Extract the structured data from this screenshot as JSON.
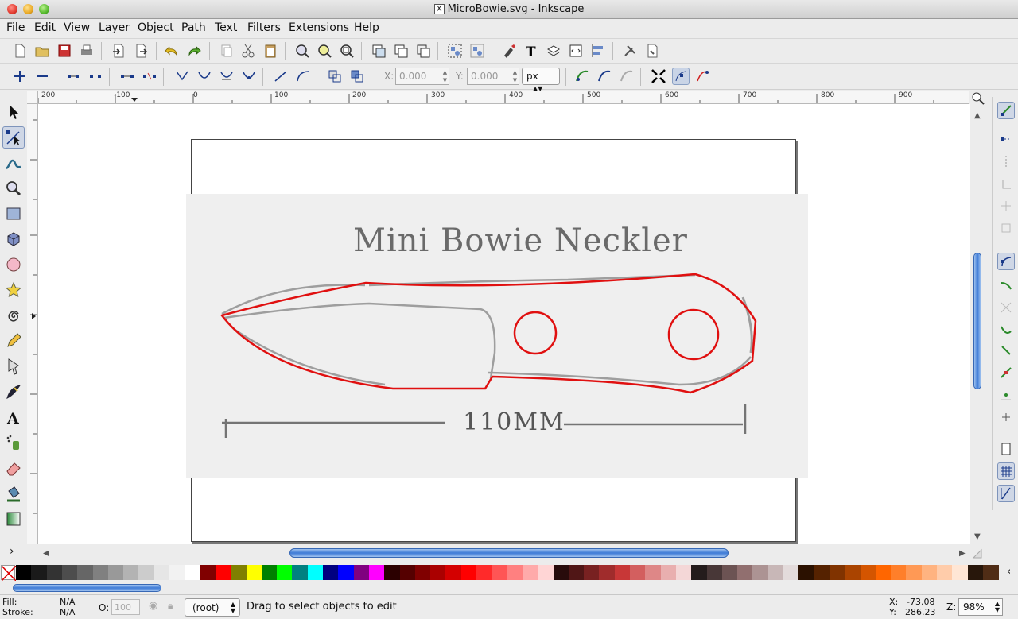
{
  "window": {
    "title": "MicroBowie.svg - Inkscape"
  },
  "menu": [
    "File",
    "Edit",
    "View",
    "Layer",
    "Object",
    "Path",
    "Text",
    "Filters",
    "Extensions",
    "Help"
  ],
  "controls": {
    "x_label": "X:",
    "x_value": "0.000",
    "y_label": "Y:",
    "y_value": "0.000",
    "unit": "px"
  },
  "ruler": {
    "h_labels": [
      "200",
      "-100",
      "0",
      "100",
      "200",
      "300",
      "400",
      "500",
      "600",
      "700",
      "800",
      "900"
    ]
  },
  "drawing": {
    "title_text": "Mini Bowie Neckler",
    "dimension_text": "110MM",
    "outline_color": "#e01010"
  },
  "palette": {
    "colors": [
      "#000000",
      "#1a1a1a",
      "#333333",
      "#4d4d4d",
      "#666666",
      "#808080",
      "#999999",
      "#b3b3b3",
      "#cccccc",
      "#e6e6e6",
      "#f2f2f2",
      "#ffffff",
      "#800000",
      "#ff0000",
      "#808000",
      "#ffff00",
      "#008000",
      "#00ff00",
      "#008080",
      "#00ffff",
      "#000080",
      "#0000ff",
      "#800080",
      "#ff00ff",
      "#2b0000",
      "#550000",
      "#800000",
      "#aa0000",
      "#d40000",
      "#ff0000",
      "#ff2a2a",
      "#ff5555",
      "#ff8080",
      "#ffaaaa",
      "#ffd5d5",
      "#280b0b",
      "#501616",
      "#782121",
      "#a02c2c",
      "#c83737",
      "#d35f5f",
      "#de8787",
      "#e9afaf",
      "#f4d7d7",
      "#241c1c",
      "#483737",
      "#6c5353",
      "#916f6f",
      "#ac9393",
      "#c8b7b7",
      "#e3dbdb",
      "#2b1100",
      "#552200",
      "#803300",
      "#aa4400",
      "#d45500",
      "#ff6600",
      "#ff7f2a",
      "#ff9955",
      "#ffb380",
      "#ffccaa",
      "#ffe6d5",
      "#28170b",
      "#502d16"
    ]
  },
  "status": {
    "fill_label": "Fill:",
    "fill_value": "N/A",
    "stroke_label": "Stroke:",
    "stroke_value": "N/A",
    "opacity_label": "O:",
    "opacity_value": "100",
    "layer": "(root)",
    "message": "Drag to select objects to edit",
    "x_label": "X:",
    "x_value": "-73.08",
    "y_label": "Y:",
    "y_value": "286.23",
    "zoom_label": "Z:",
    "zoom_value": "98%"
  }
}
